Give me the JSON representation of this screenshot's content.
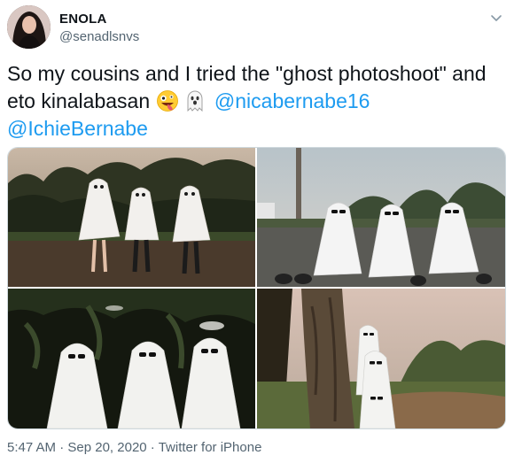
{
  "author": {
    "display_name": "ENOLA",
    "handle": "@senadlsnvs"
  },
  "tweet": {
    "text_part1": "So my cousins and I tried the \"ghost photoshoot\" and eto kinalabasan",
    "emojis": [
      "zany-face",
      "ghost"
    ],
    "mention_1": "@nicabernabe16",
    "mention_2": "@IchieBernabe"
  },
  "footer": {
    "time": "5:47 AM",
    "separator_1": " · ",
    "date": "Sep 20, 2020",
    "separator_2": " · ",
    "source": "Twitter for iPhone"
  },
  "colors": {
    "link": "#1d9bf0",
    "text": "#0f1419",
    "secondary": "#536471",
    "border": "#cfd9de"
  },
  "icons": [
    "chevron-down-icon",
    "zany-face-emoji-icon",
    "ghost-emoji-icon"
  ]
}
